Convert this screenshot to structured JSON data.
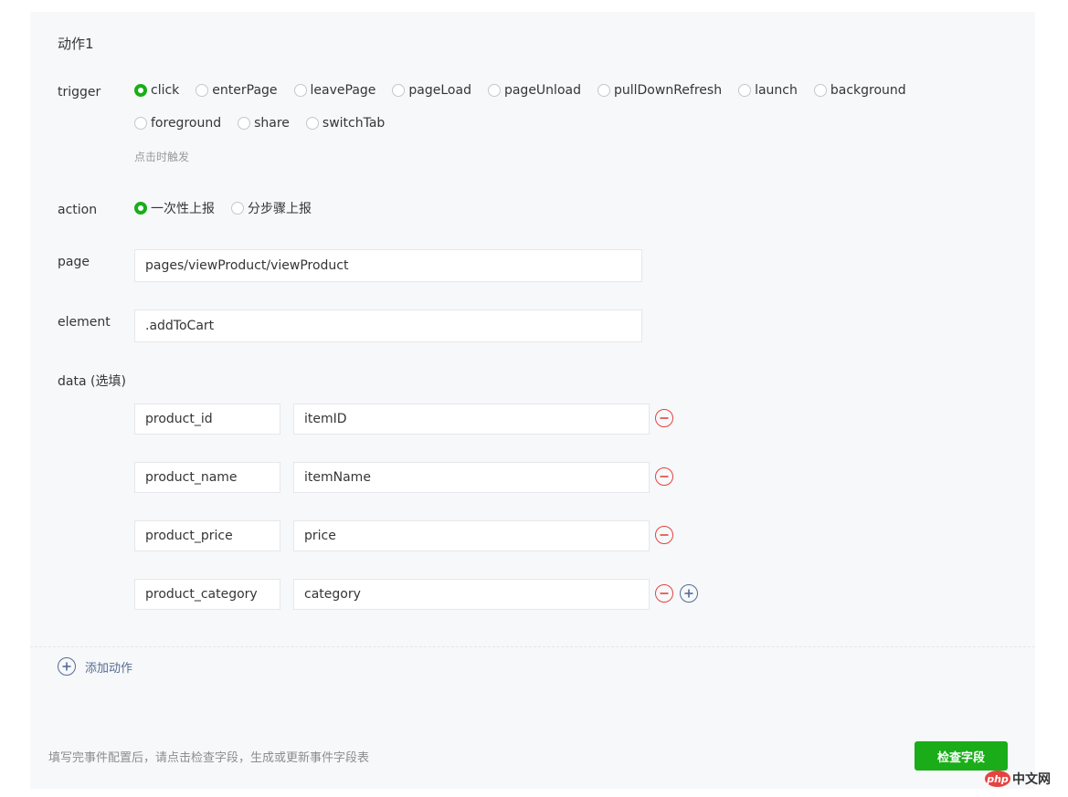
{
  "action": {
    "title": "动作1"
  },
  "trigger": {
    "label": "trigger",
    "options_row1": [
      "click",
      "enterPage",
      "leavePage",
      "pageLoad",
      "pageUnload",
      "pullDownRefresh",
      "launch",
      "background"
    ],
    "options_row2": [
      "foreground",
      "share",
      "switchTab"
    ],
    "selected": "click",
    "hint": "点击时触发"
  },
  "report": {
    "label": "action",
    "options": [
      "一次性上报",
      "分步骤上报"
    ],
    "selected": "一次性上报"
  },
  "page": {
    "label": "page",
    "value": "pages/viewProduct/viewProduct"
  },
  "element": {
    "label": "element",
    "value": ".addToCart"
  },
  "data": {
    "label": "data (选填)",
    "rows": [
      {
        "key": "product_id",
        "value": "itemID"
      },
      {
        "key": "product_name",
        "value": "itemName"
      },
      {
        "key": "product_price",
        "value": "price"
      },
      {
        "key": "product_category",
        "value": "category"
      }
    ]
  },
  "add_action": {
    "label": "添加动作"
  },
  "footer": {
    "note": "填写完事件配置后，请点击检查字段，生成或更新事件字段表",
    "check_button": "检查字段"
  },
  "watermark": {
    "logo": "php",
    "text": "中文网"
  },
  "colors": {
    "accent_green": "#1aad19",
    "remove_red": "#e64340",
    "link_blue": "#576b95",
    "panel_bg": "#f6f8f9"
  }
}
